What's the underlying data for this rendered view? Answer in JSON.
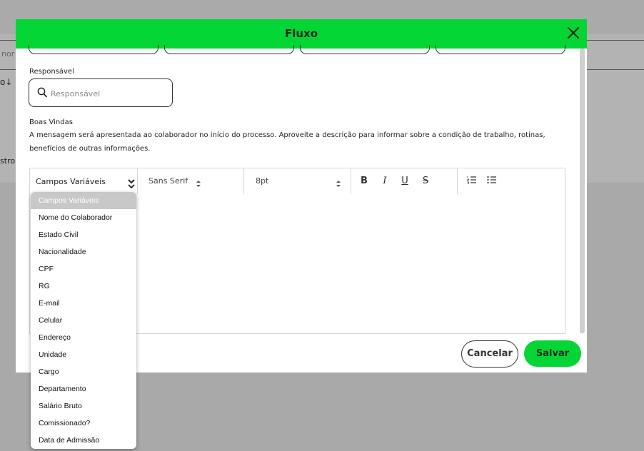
{
  "background": {
    "search_partial": "nor",
    "sort_partial": "o↓",
    "register_partial": "stro"
  },
  "modal": {
    "title": "Fluxo",
    "responsavel_label": "Responsável",
    "responsavel_placeholder": "Responsável",
    "boas_vindas_label": "Boas Vindas",
    "boas_vindas_description_line1": "A mensagem será apresentada ao colaborador no início do processo. Aproveite a descrição para informar sobre a condição de trabalho, rotinas,",
    "boas_vindas_description_line2": "benefícios de outras informações.",
    "cancel_label": "Cancelar",
    "save_label": "Salvar"
  },
  "toolbar": {
    "variables_select_value": "Campos Variáveis",
    "font_value": "Sans Serif",
    "size_value": "8pt",
    "bold": "B",
    "italic": "I",
    "underline": "U",
    "strike": "S"
  },
  "dropdown": {
    "options": [
      "Campos Variáveis",
      "Nome do Colaborador",
      "Estado Civil",
      "Nacionalidade",
      "CPF",
      "RG",
      "E-mail",
      "Celular",
      "Endereço",
      "Unidade",
      "Cargo",
      "Departamento",
      "Salário Bruto",
      "Comissionado?",
      "Data de Admissão"
    ],
    "selected_index": 0
  },
  "colors": {
    "accent": "#03d634",
    "overlay": "#a9a9a9"
  }
}
